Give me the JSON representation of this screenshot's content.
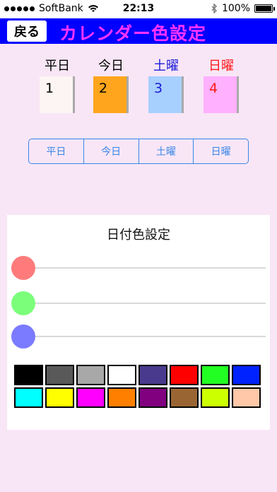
{
  "status": {
    "carrier": "SoftBank",
    "time": "22:13",
    "battery": "100%",
    "battery_level": 1.0
  },
  "header": {
    "back_label": "戻る",
    "title": "カレンダー色設定",
    "bg_color": "#0000ff",
    "title_color": "#ff33ff"
  },
  "samples": [
    {
      "label": "平日",
      "label_color": "#000000",
      "value": "1",
      "bg": "#fdf5f3",
      "text_color": "#000000"
    },
    {
      "label": "今日",
      "label_color": "#000000",
      "value": "2",
      "bg": "#ffa51d",
      "text_color": "#000000"
    },
    {
      "label": "土曜",
      "label_color": "#1a1ad8",
      "value": "3",
      "bg": "#a8d0ff",
      "text_color": "#1a1ad8"
    },
    {
      "label": "日曜",
      "label_color": "#ff1a1a",
      "value": "4",
      "bg": "#ffb0ff",
      "text_color": "#ff1a1a"
    }
  ],
  "segments": [
    "平日",
    "今日",
    "土曜",
    "日曜"
  ],
  "panel": {
    "title": "日付色設定",
    "sliders": [
      {
        "color": "#ff7b7b",
        "value": 0
      },
      {
        "color": "#7bff7b",
        "value": 0
      },
      {
        "color": "#7b7bff",
        "value": 0
      }
    ],
    "swatches": [
      "#000000",
      "#595959",
      "#a8a8a8",
      "#ffffff",
      "#4a3a8e",
      "#ff0000",
      "#22ff22",
      "#0022ff",
      "#00ffff",
      "#ffff00",
      "#ff00ff",
      "#ff8000",
      "#800080",
      "#996633",
      "#ccff00",
      "#ffc8a8"
    ]
  }
}
